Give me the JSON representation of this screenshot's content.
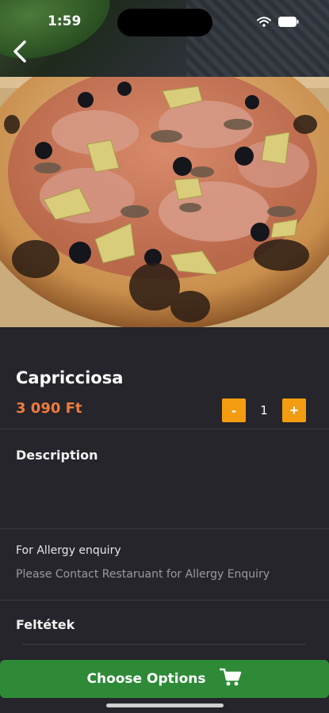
{
  "status_bar": {
    "time": "1:59"
  },
  "nav": {
    "back_icon": "chevron-left-icon"
  },
  "product": {
    "name": "Capricciosa",
    "price": "3 090 Ft",
    "price_color": "#f07b3b"
  },
  "quantity": {
    "minus_label": "-",
    "value": "1",
    "plus_label": "+",
    "button_color": "#f39c12"
  },
  "sections": {
    "description_heading": "Description",
    "allergy_label": "For Allergy enquiry",
    "allergy_text": "Please Contact Restaruant for Allergy Enquiry",
    "toppings_heading": "Feltétek"
  },
  "cta": {
    "label": "Choose Options",
    "icon": "cart-icon",
    "color": "#2e8a37"
  }
}
